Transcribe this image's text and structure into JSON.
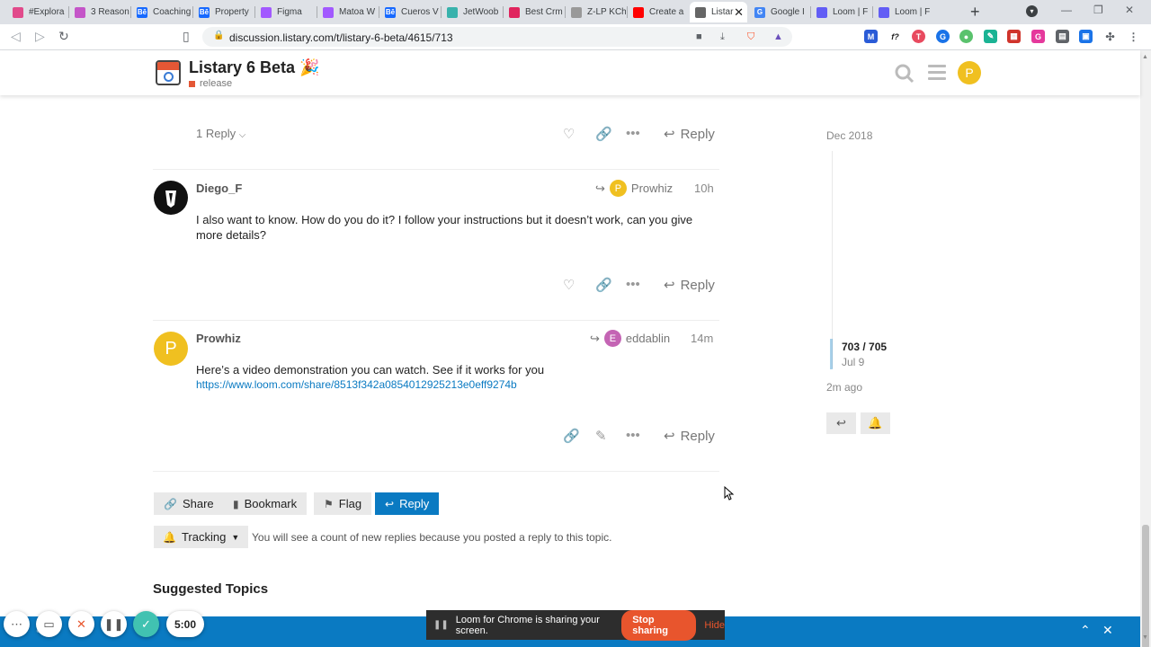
{
  "browser": {
    "tabs": [
      {
        "title": "#Explora",
        "color": "#e14a8b",
        "glyph": ""
      },
      {
        "title": "3 Reason",
        "color": "#c455c8",
        "glyph": ""
      },
      {
        "title": "Coaching",
        "color": "#1769ff",
        "glyph": "Bē"
      },
      {
        "title": "Property",
        "color": "#1769ff",
        "glyph": "Bē"
      },
      {
        "title": "Figma",
        "color": "#a259ff",
        "glyph": ""
      },
      {
        "title": "Matoa W",
        "color": "#a259ff",
        "glyph": ""
      },
      {
        "title": "Cueros V",
        "color": "#1769ff",
        "glyph": "Bē"
      },
      {
        "title": "JetWoob",
        "color": "#38b2ac",
        "glyph": ""
      },
      {
        "title": "Best Crm",
        "color": "#e0245e",
        "glyph": ""
      },
      {
        "title": "Z-LP KCh",
        "color": "#999999",
        "glyph": ""
      },
      {
        "title": "Create a",
        "color": "#ff0000",
        "glyph": ""
      },
      {
        "title": "Listar",
        "color": "#666666",
        "glyph": ""
      },
      {
        "title": "Google I",
        "color": "#4285f4",
        "glyph": "G"
      },
      {
        "title": "Loom | F",
        "color": "#625df5",
        "glyph": ""
      },
      {
        "title": "Loom | F",
        "color": "#625df5",
        "glyph": ""
      }
    ],
    "url": "discussion.listary.com/t/listary-6-beta/4615/713"
  },
  "header": {
    "title": "Listary 6 Beta 🎉",
    "category": "release",
    "avatar_letter": "P"
  },
  "prev_post": {
    "replies_label": "1 Reply",
    "reply_label": "Reply"
  },
  "posts": [
    {
      "username": "Diego_F",
      "reply_to": "Prowhiz",
      "reply_to_initial": "P",
      "reply_to_color": "#f0c020",
      "age": "10h",
      "body": "I also want to know. How do you do it? I follow your instructions but it doesn’t work, can you give more details?",
      "link": "",
      "reply_label": "Reply"
    },
    {
      "username": "Prowhiz",
      "avatar_letter": "P",
      "reply_to": "eddablin",
      "reply_to_initial": "E",
      "reply_to_color": "#c464b4",
      "age": "14m",
      "body": "Here’s a video demonstration you can watch. See if it works for you",
      "link": "https://www.loom.com/share/8513f342a0854012925213e0eff9274b",
      "reply_label": "Reply"
    }
  ],
  "footer": {
    "share": "Share",
    "bookmark": "Bookmark",
    "flag": "Flag",
    "reply": "Reply",
    "tracking": "Tracking",
    "tracking_text": "You will see a count of new replies because you posted a reply to this topic.",
    "suggested": "Suggested Topics"
  },
  "timeline": {
    "start": "Dec 2018",
    "position": "703 / 705",
    "position_date": "Jul 9",
    "end": "2m ago"
  },
  "loom": {
    "timer": "5:00",
    "message": "Loom for Chrome is sharing your screen.",
    "stop": "Stop sharing",
    "hide": "Hide"
  },
  "colors": {
    "accent": "#0a7ac2",
    "brand": "#e45735"
  }
}
